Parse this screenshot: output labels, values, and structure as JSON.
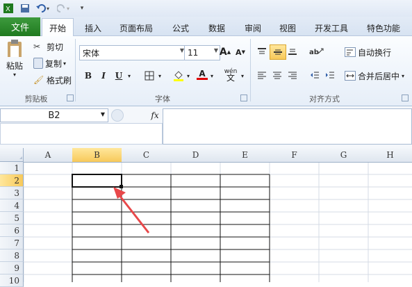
{
  "app": {
    "brand_color": "#1f7a1f",
    "accent_color": "#f7c95a"
  },
  "qat": {
    "items": [
      "excel-icon",
      "save-icon",
      "undo-icon",
      "redo-icon",
      "customize-icon"
    ]
  },
  "tabs": {
    "file": "文件",
    "home": "开始",
    "insert": "插入",
    "page_layout": "页面布局",
    "formulas": "公式",
    "data": "数据",
    "review": "审阅",
    "view": "视图",
    "developer": "开发工具",
    "special": "特色功能"
  },
  "clipboard": {
    "paste": "粘贴",
    "cut": "剪切",
    "copy": "复制",
    "format_painter": "格式刷",
    "label": "剪贴板"
  },
  "font": {
    "name": "宋体",
    "size": "11",
    "bold": "B",
    "italic": "I",
    "underline": "U",
    "grow": "A",
    "shrink": "A",
    "color_letter": "A",
    "wen": "wén",
    "label": "字体"
  },
  "alignment": {
    "wrap": "自动换行",
    "merge": "合并后居中",
    "label": "对齐方式"
  },
  "formula_bar": {
    "name_box": "B2",
    "fx": "fx",
    "content": ""
  },
  "sheet": {
    "columns": [
      "A",
      "B",
      "C",
      "D",
      "E",
      "F",
      "G",
      "H"
    ],
    "rows": [
      "1",
      "2",
      "3",
      "4",
      "5",
      "6",
      "7",
      "8",
      "9",
      "10"
    ],
    "selected_cell": "B2",
    "annotation": "red-arrow"
  }
}
